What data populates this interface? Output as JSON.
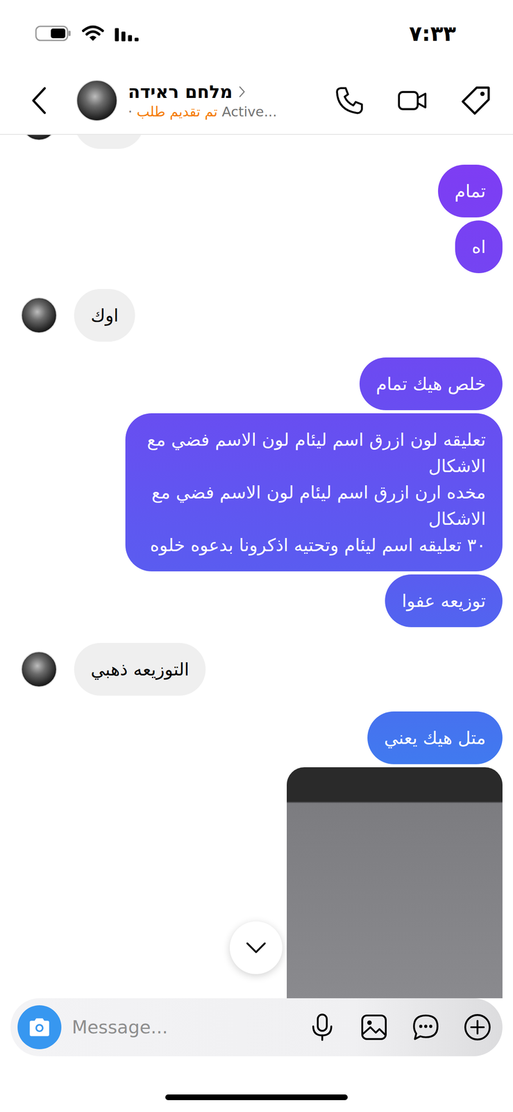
{
  "status_bar": {
    "time": "٧:٣٣"
  },
  "header": {
    "name": "מלחם ראידה",
    "separator": "·",
    "request_status": "تم تقديم طلب",
    "activity": "Active..."
  },
  "messages": [
    {
      "from": "them",
      "kind": "partial"
    },
    {
      "from": "me",
      "kind": "text",
      "text": "تمام"
    },
    {
      "from": "me",
      "kind": "text",
      "text": "اه"
    },
    {
      "from": "them",
      "kind": "text",
      "text": "اوك"
    },
    {
      "from": "me",
      "kind": "text",
      "text": "خلص هيك تمام"
    },
    {
      "from": "me",
      "kind": "text",
      "text": "تعليقه لون ازرق اسم ليئام لون الاسم فضي مع الاشكال\nمخده ارن ازرق اسم ليئام لون الاسم فضي مع الاشكال\n٣٠ تعليقه اسم ليئام وتحتيه اذكرونا بدعوه خلوه"
    },
    {
      "from": "me",
      "kind": "text",
      "text": "توزيعه عفوا"
    },
    {
      "from": "them",
      "kind": "text",
      "text": "التوزيعه ذهبي"
    },
    {
      "from": "me",
      "kind": "text",
      "text": "متل هيك يعني"
    },
    {
      "from": "me",
      "kind": "image"
    }
  ],
  "composer": {
    "placeholder": "Message..."
  }
}
